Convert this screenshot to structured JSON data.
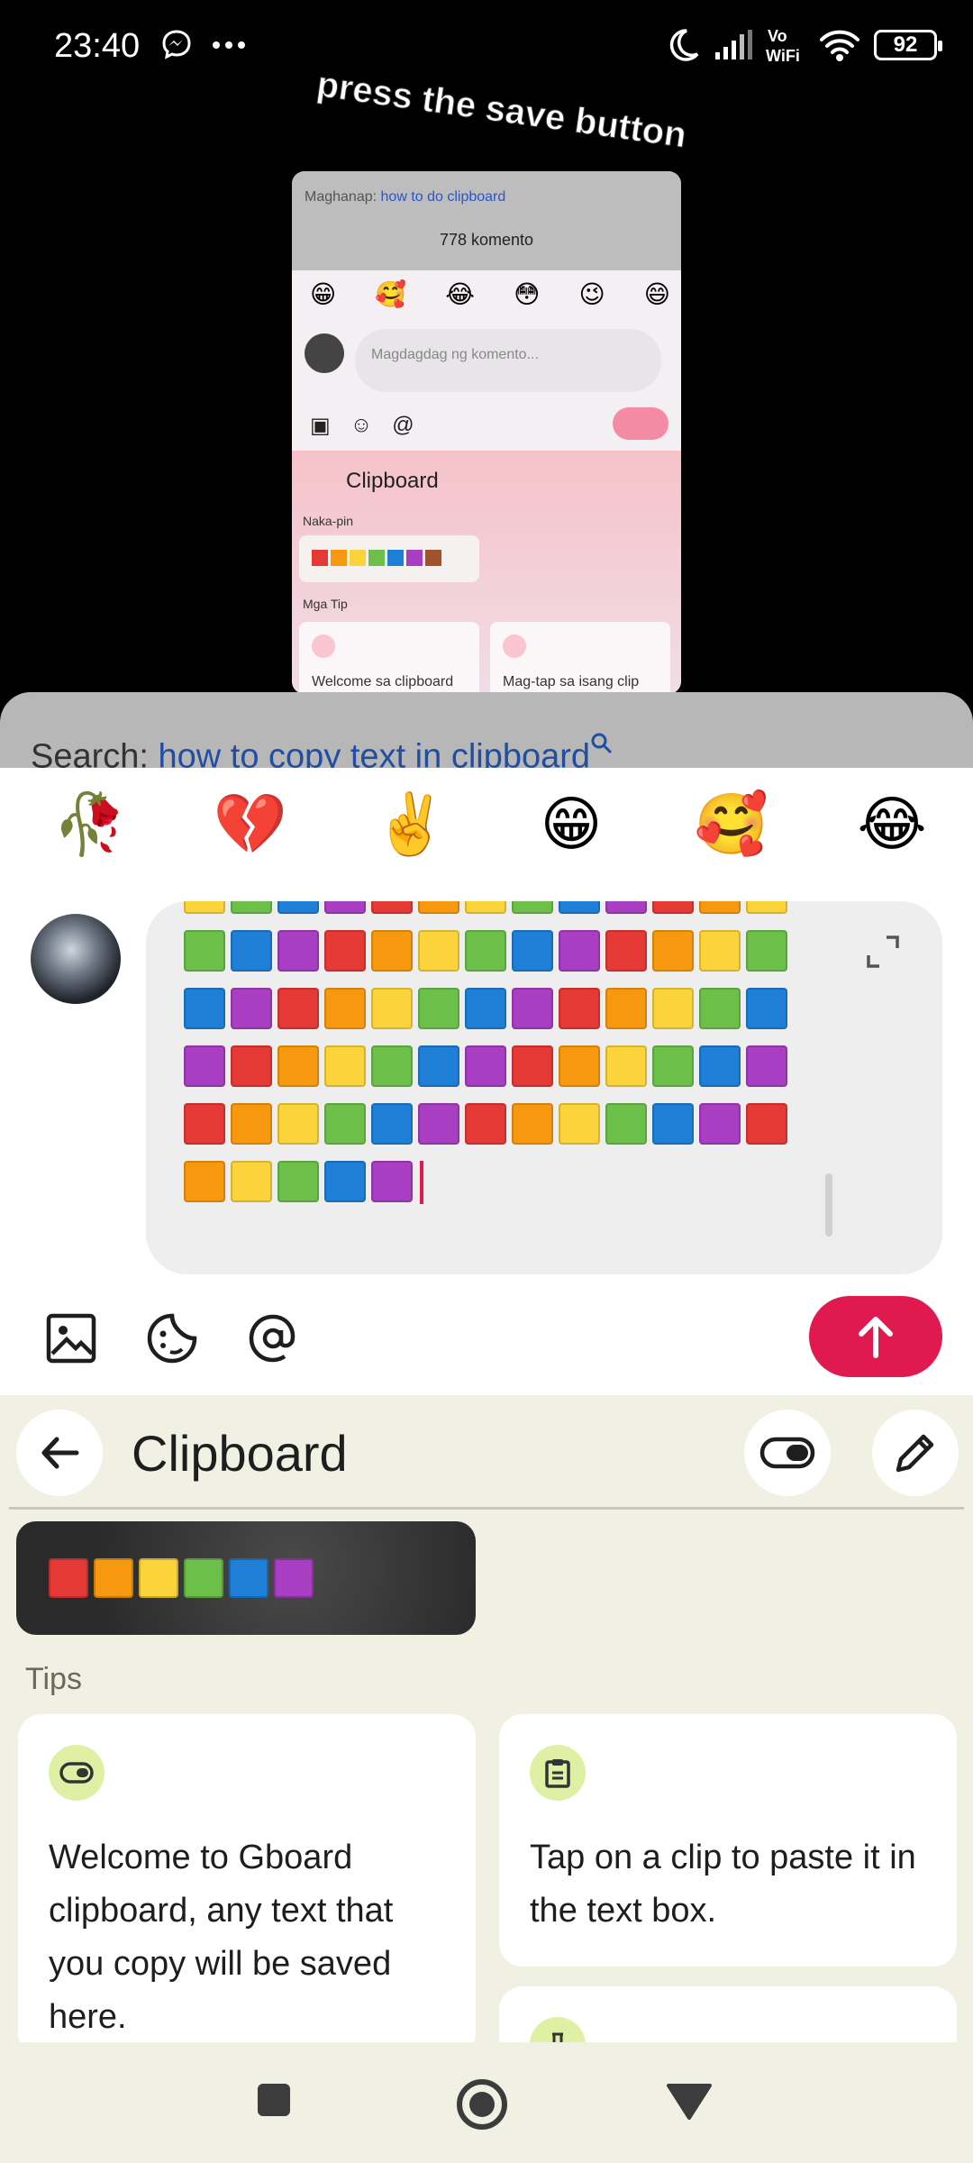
{
  "status_bar": {
    "time": "23:40",
    "battery": "92",
    "volte": "Vo WiFi"
  },
  "video": {
    "caption": "press the save button",
    "search_prefix": "Maghanap:",
    "search_query": "how to do clipboard",
    "comment_count": "778 komento",
    "emojis": [
      "😁",
      "🥰",
      "😂",
      "😳",
      "😉",
      "😄"
    ],
    "input_placeholder": "Magdagdag ng komento...",
    "clipboard_title": "Clipboard",
    "pinned_label": "Naka-pin",
    "tips_label": "Mga Tip",
    "tip1": "Welcome sa clipboard",
    "tip2": "Mag-tap sa isang clip"
  },
  "comments_sheet": {
    "search_prefix": "Search:",
    "search_query": "how to copy text in clipboard",
    "emoji_reactions": [
      "🥀",
      "💔",
      "✌️",
      "😁",
      "🥰",
      "😂"
    ]
  },
  "colors": {
    "red": "#e53935",
    "orange": "#f7990f",
    "yellow": "#fbd33a",
    "green": "#6cc04a",
    "blue": "#1f7fd6",
    "purple": "#a83ec2",
    "accent": "#e0194f",
    "keyboard_bg": "#f0f0e3"
  },
  "icons": {
    "expand": "expand-icon",
    "image": "image-icon",
    "sticker": "sticker-icon",
    "mention": "at-sign-icon",
    "send": "arrow-up-icon",
    "back": "arrow-left-icon",
    "toggle": "toggle-icon",
    "edit": "pencil-icon"
  },
  "clipboard": {
    "title": "Clipboard",
    "tips_label": "Tips",
    "tip_cards": [
      {
        "text": "Welcome to Gboard clipboard, any text that you copy will be saved here."
      },
      {
        "text": "Tap on a clip to paste it in the text box."
      }
    ]
  }
}
